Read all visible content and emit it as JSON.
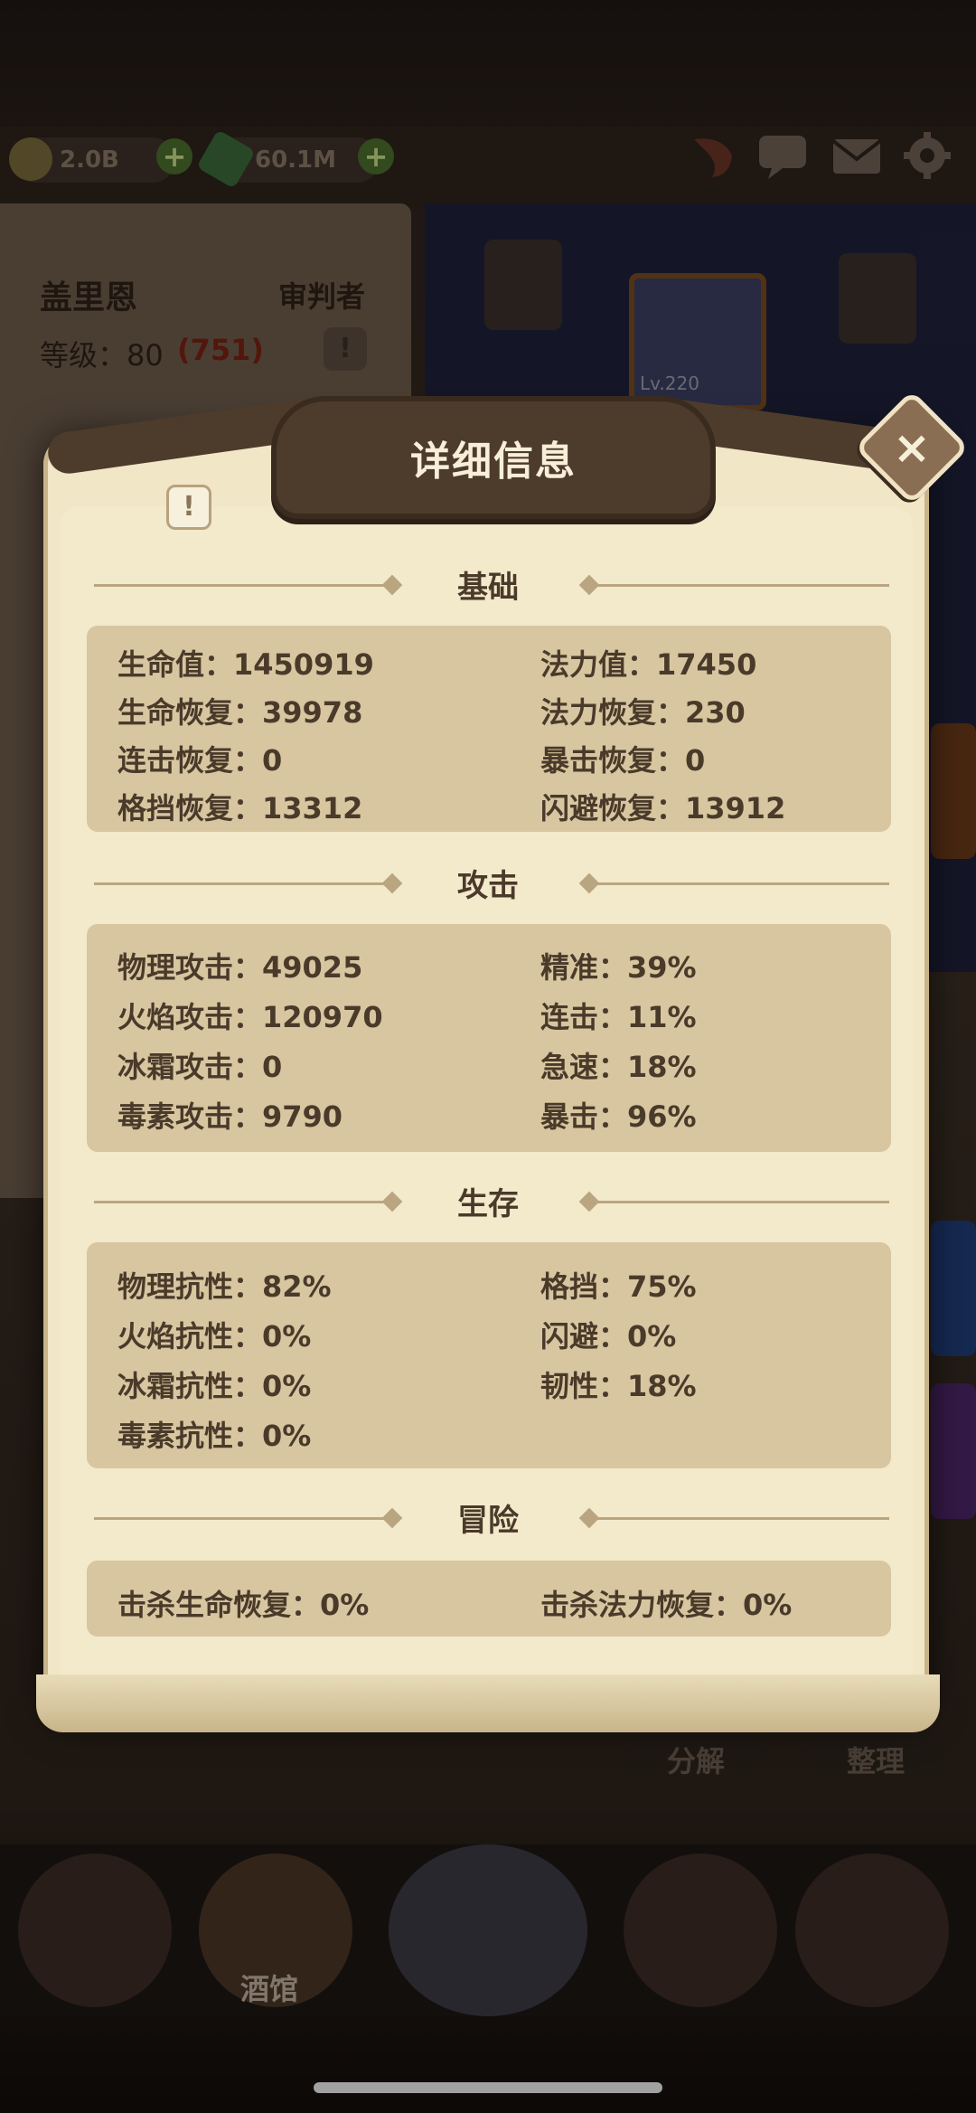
{
  "currency": {
    "gold": "2.0B",
    "gems": "60.1M"
  },
  "hero": {
    "name": "盖里恩",
    "class": "审判者",
    "level": "等级：80",
    "level_extra": "(751)"
  },
  "equipment": {
    "level_label": "Lv.220"
  },
  "background_buttons": {
    "decompose": "分解",
    "organize": "整理"
  },
  "nav": {
    "active_label": "酒馆"
  },
  "modal": {
    "title": "详细信息",
    "sections": [
      {
        "title": "基础",
        "left": [
          "生命值：1450919",
          "生命恢复：39978",
          "连击恢复：0",
          "格挡恢复：13312"
        ],
        "right": [
          "法力值：17450",
          "法力恢复：230",
          "暴击恢复：0",
          "闪避恢复：13912"
        ]
      },
      {
        "title": "攻击",
        "left": [
          "物理攻击：49025",
          "火焰攻击：120970",
          "冰霜攻击：0",
          "毒素攻击：9790"
        ],
        "right": [
          "精准：39%",
          "连击：11%",
          "急速：18%",
          "暴击：96%"
        ]
      },
      {
        "title": "生存",
        "left": [
          "物理抗性：82%",
          "火焰抗性：0%",
          "冰霜抗性：0%",
          "毒素抗性：0%"
        ],
        "right": [
          "格挡：75%",
          "闪避：0%",
          "韧性：18%"
        ]
      },
      {
        "title": "冒险",
        "left": [
          "击杀生命恢复：0%"
        ],
        "right": [
          "击杀法力恢复：0%"
        ]
      }
    ]
  },
  "icons": {
    "info": "!",
    "close": "×",
    "plus": "+"
  },
  "colors": {
    "parchment": "#f1e6c6",
    "stat_box": "#d7c6a0",
    "text": "#4a3a2a",
    "banner": "#4d3b2c"
  }
}
